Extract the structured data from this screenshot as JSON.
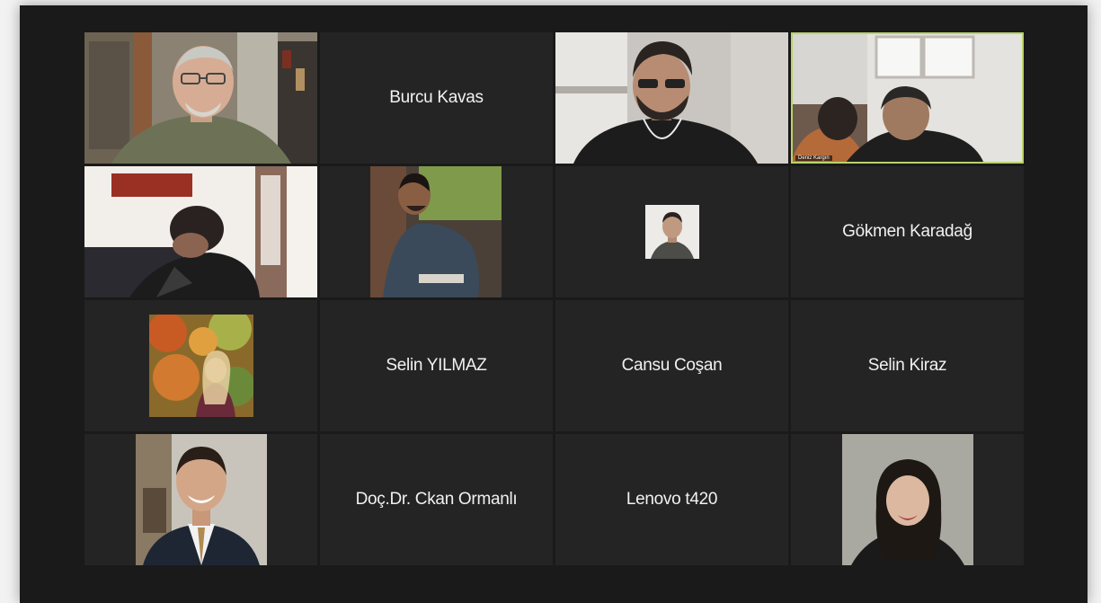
{
  "meeting": {
    "participants": [
      {
        "name": "",
        "type": "video",
        "scene": "older-man-glasses-bookshelf"
      },
      {
        "name": "Burcu Kavas",
        "type": "name"
      },
      {
        "name": "",
        "type": "video",
        "scene": "man-headphones-glasses"
      },
      {
        "name": "Deniz Kargın",
        "type": "video",
        "scene": "two-people-window",
        "active": true
      },
      {
        "name": "",
        "type": "video",
        "scene": "person-leaning-room"
      },
      {
        "name": "",
        "type": "photo",
        "scene": "man-portrait-trees"
      },
      {
        "name": "",
        "type": "photo-small",
        "scene": "id-photo"
      },
      {
        "name": "Gökmen Karadağ",
        "type": "name"
      },
      {
        "name": "",
        "type": "photo",
        "scene": "woman-autumn-leaves"
      },
      {
        "name": "Selin YILMAZ",
        "type": "name"
      },
      {
        "name": "Cansu Coşan",
        "type": "name"
      },
      {
        "name": "Selin Kiraz",
        "type": "name"
      },
      {
        "name": "",
        "type": "photo",
        "scene": "man-suit-smiling"
      },
      {
        "name": "Doç.Dr. Ckan Ormanlı",
        "type": "name"
      },
      {
        "name": "Lenovo t420",
        "type": "name"
      },
      {
        "name": "",
        "type": "photo",
        "scene": "woman-dark-hair"
      }
    ]
  },
  "colors": {
    "window_bg": "#1a1a1a",
    "tile_bg": "#242424",
    "active_speaker_border": "#b8d46a",
    "name_text": "#f1f1f1"
  }
}
